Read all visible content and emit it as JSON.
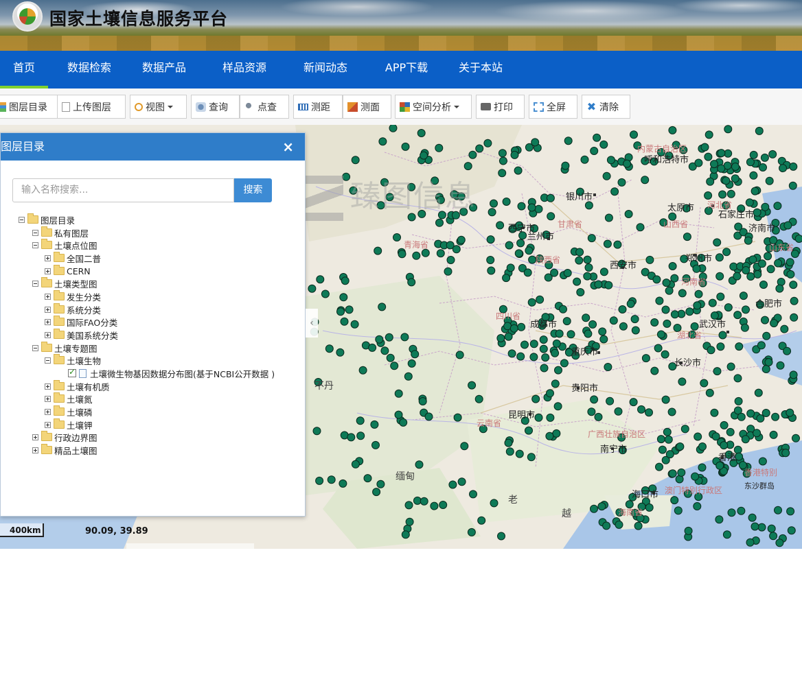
{
  "site": {
    "title": "国家土壤信息服务平台"
  },
  "nav": {
    "items": [
      {
        "label": "首页",
        "active": true
      },
      {
        "label": "数据检索"
      },
      {
        "label": "数据产品"
      },
      {
        "label": "样品资源"
      },
      {
        "label": "新闻动态"
      },
      {
        "label": "APP下载"
      },
      {
        "label": "关于本站"
      }
    ],
    "accent": "#7fd12f",
    "bar_color": "#0b5fc7"
  },
  "toolbar": {
    "layer_catalog": "图层目录",
    "upload_layer": "上传图层",
    "view": "视图",
    "query": "查询",
    "point_query": "点查",
    "measure_distance": "测距",
    "measure_area": "测面",
    "spatial_analysis": "空间分析",
    "print": "打印",
    "fullscreen": "全屏",
    "clear": "清除"
  },
  "panel": {
    "title": "图层目录",
    "close": "×",
    "search_placeholder": "输入名称搜索...",
    "search_button": "搜索",
    "collapse": "‹",
    "tree": {
      "root": "图层目录",
      "private": "私有图层",
      "points": "土壤点位图",
      "survey2": "全国二普",
      "cern": "CERN",
      "types": "土壤类型图",
      "genetic": "发生分类",
      "system": "系统分类",
      "fao": "国际FAO分类",
      "us": "美国系统分类",
      "thematic": "土壤专题图",
      "bio": "土壤生物",
      "microbe": "土壤微生物基因数据分布图(基于NCBI公开数据 )",
      "organic": "土壤有机质",
      "nitrogen": "土壤氮",
      "phosphorus": "土壤磷",
      "potassium": "土壤钾",
      "admin": "行政边界图",
      "fine": "精品土壤图"
    }
  },
  "map": {
    "watermark": "臻图信息",
    "scale": "400km",
    "coordinates": "90.09, 39.89",
    "point_color": "#0e7a57",
    "labels": {
      "hohhot": "呼和浩特市",
      "inner_mongolia": "内蒙古自治区",
      "yinchuan": "银川市",
      "taiyuan": "太原市",
      "shijiazhuang": "石家庄市",
      "lanzhou": "兰州市",
      "xining": "西宁市",
      "qinghai": "青海省",
      "gansu": "甘肃省",
      "xian": "西安市",
      "zhengzhou": "郑州市",
      "henan": "河南省",
      "shaanxi": "陕西省",
      "shanxi": "山西省",
      "hebei": "河北省",
      "shandong": "山东省",
      "jinan": "济南市",
      "hefei": "合肥市",
      "wuhan": "武汉市",
      "hubei": "湖北省",
      "sichuan": "四川省",
      "chengdu": "成都市",
      "chongqing": "重庆市",
      "changsha": "长沙市",
      "guiyang": "贵阳市",
      "kunming": "昆明市",
      "yunnan": "云南省",
      "guangxi": "广西壮族自治区",
      "nanning": "南宁市",
      "hongkong": "香港",
      "hk_region": "香港特别",
      "macau": "澳门特别行政区",
      "haikou": "海口市",
      "hainan": "海南省",
      "myanmar": "缅甸",
      "laos": "老",
      "vietnam": "越",
      "bhutan": "不丹",
      "dongsha": "东沙群岛",
      "guangzhou": "广州"
    }
  }
}
